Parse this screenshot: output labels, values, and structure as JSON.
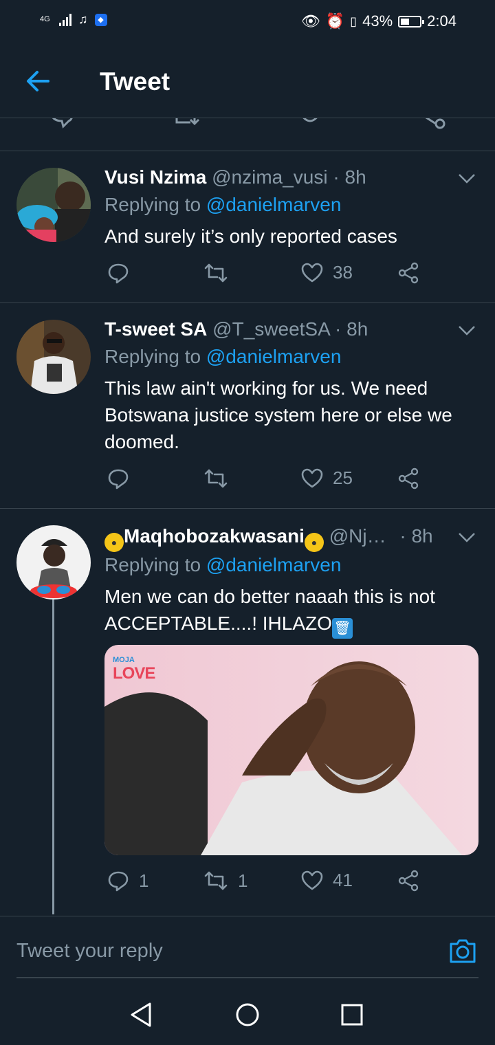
{
  "status_bar": {
    "network": "4G",
    "battery": "43%",
    "time": "2:04"
  },
  "app_bar": {
    "title": "Tweet"
  },
  "tweets": [
    {
      "name": "Vusi Nzima",
      "handle": "@nzima_vusi",
      "time": "8h",
      "replying_prefix": "Replying to",
      "replying_to": "@danielmarven",
      "text": "And surely it’s only reported cases",
      "replies": "",
      "retweets": "",
      "likes": "38"
    },
    {
      "name": "T-sweet SA",
      "handle": "@T_sweetSA",
      "time": "8h",
      "replying_prefix": "Replying to",
      "replying_to": "@danielmarven",
      "text": "This law ain't working for us. We need Botswana justice system here or else we doomed.",
      "replies": "",
      "retweets": "",
      "likes": "25"
    },
    {
      "name": "Maqhobozakwasani",
      "handle": "@Nj…",
      "time": "8h",
      "replying_prefix": "Replying to",
      "replying_to": "@danielmarven",
      "text": "Men we can do better naaah this is not ACCEPTABLE....! IHLAZO",
      "media_watermark_small": "MOJA",
      "media_watermark": "LOVE",
      "replies": "1",
      "retweets": "1",
      "likes": "41"
    }
  ],
  "reply_bar": {
    "placeholder": "Tweet your reply"
  },
  "colors": {
    "background": "#15202b",
    "accent": "#1da1f2",
    "secondary_text": "#8899a6",
    "divider": "#38444d"
  }
}
